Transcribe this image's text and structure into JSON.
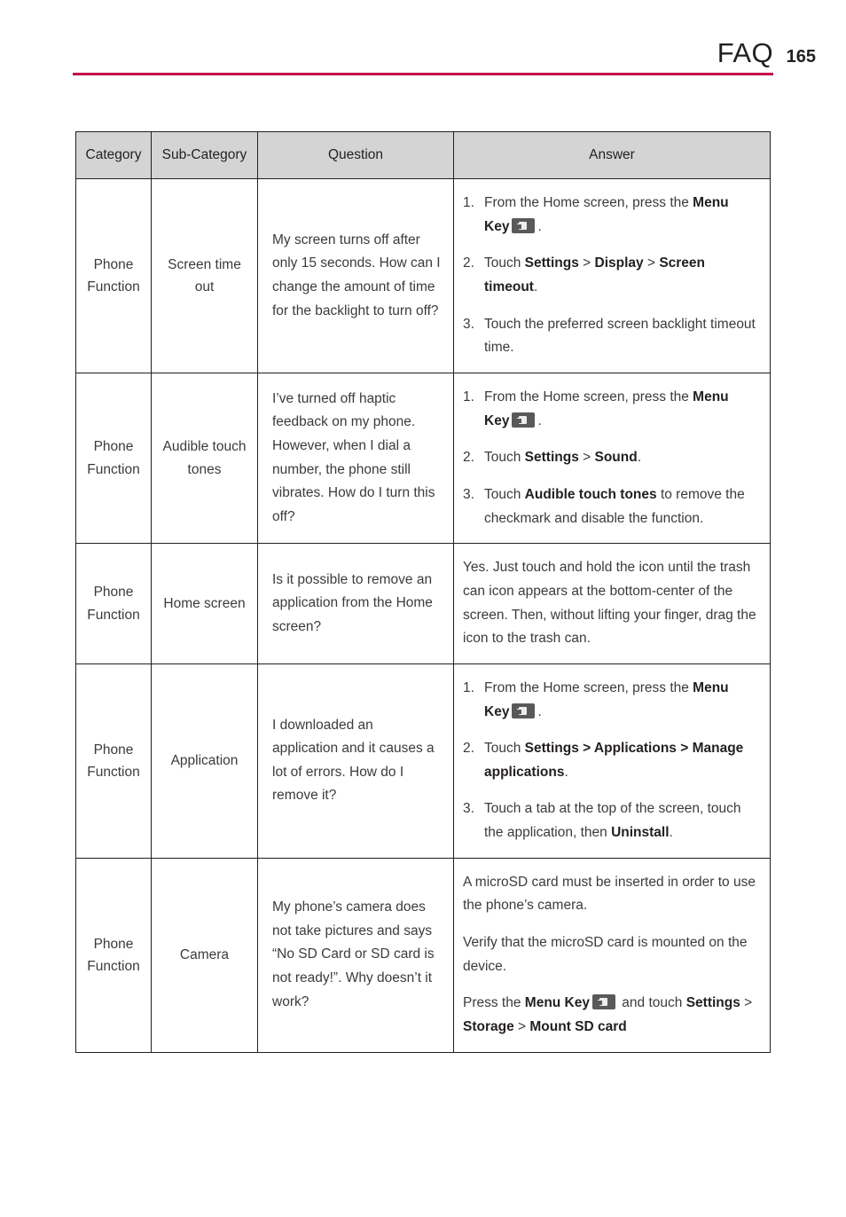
{
  "header": {
    "title": "FAQ",
    "page_number": "165",
    "rule_color": "#c4004d"
  },
  "table": {
    "header_bg": "#d4d4d4",
    "columns": [
      "Category",
      "Sub-Category",
      "Question",
      "Answer"
    ],
    "rows": [
      {
        "category": "Phone Function",
        "subcategory": "Screen time out",
        "question": "My screen turns off after only 15 seconds. How can I change the amount of time for the backlight to turn off?",
        "answer_steps": [
          {
            "num": "1.",
            "segments": [
              {
                "text": "From the Home screen, press the ",
                "bold": false
              },
              {
                "text": "Menu Key",
                "bold": true
              },
              {
                "icon": "menu-key-icon"
              },
              {
                "text": ".",
                "bold": false
              }
            ]
          },
          {
            "num": "2.",
            "segments": [
              {
                "text": "Touch ",
                "bold": false
              },
              {
                "text": "Settings",
                "bold": true
              },
              {
                "text": " > ",
                "bold": false
              },
              {
                "text": "Display",
                "bold": true
              },
              {
                "text": " > ",
                "bold": false
              },
              {
                "text": "Screen timeout",
                "bold": true
              },
              {
                "text": ".",
                "bold": false
              }
            ]
          },
          {
            "num": "3.",
            "segments": [
              {
                "text": "Touch the preferred screen backlight timeout time.",
                "bold": false
              }
            ]
          }
        ]
      },
      {
        "category": "Phone Function",
        "subcategory": "Audible touch tones",
        "question": "I’ve turned off haptic feedback on my phone. However, when I dial a number, the phone still vibrates. How do I turn this off?",
        "answer_steps": [
          {
            "num": "1.",
            "segments": [
              {
                "text": "From the Home screen, press the ",
                "bold": false
              },
              {
                "text": "Menu Key",
                "bold": true
              },
              {
                "icon": "menu-key-icon"
              },
              {
                "text": ".",
                "bold": false
              }
            ]
          },
          {
            "num": "2.",
            "segments": [
              {
                "text": "Touch ",
                "bold": false
              },
              {
                "text": "Settings",
                "bold": true
              },
              {
                "text": " > ",
                "bold": false
              },
              {
                "text": "Sound",
                "bold": true
              },
              {
                "text": ".",
                "bold": false
              }
            ]
          },
          {
            "num": "3.",
            "segments": [
              {
                "text": "Touch ",
                "bold": false
              },
              {
                "text": "Audible touch tones",
                "bold": true
              },
              {
                "text": " to remove the checkmark and disable the function.",
                "bold": false
              }
            ]
          }
        ]
      },
      {
        "category": "Phone Function",
        "subcategory": "Home screen",
        "question": "Is it possible to remove an application from the Home screen?",
        "answer_paragraphs": [
          {
            "segments": [
              {
                "text": "Yes. Just touch and hold the icon until the trash can icon appears at the bottom-center of the screen. Then, without lifting your finger, drag the icon to the trash can.",
                "bold": false
              }
            ]
          }
        ]
      },
      {
        "category": "Phone Function",
        "subcategory": "Application",
        "question": "I downloaded an application and it causes a lot of errors. How do I remove it?",
        "answer_steps": [
          {
            "num": "1.",
            "segments": [
              {
                "text": "From the Home screen, press the ",
                "bold": false
              },
              {
                "text": "Menu Key",
                "bold": true
              },
              {
                "icon": "menu-key-icon"
              },
              {
                "text": ".",
                "bold": false
              }
            ]
          },
          {
            "num": "2.",
            "segments": [
              {
                "text": "Touch ",
                "bold": false
              },
              {
                "text": "Settings > Applications > Manage applications",
                "bold": true
              },
              {
                "text": ".",
                "bold": false
              }
            ]
          },
          {
            "num": "3.",
            "segments": [
              {
                "text": "Touch a tab at the top of the screen, touch the application, then ",
                "bold": false
              },
              {
                "text": "Uninstall",
                "bold": true
              },
              {
                "text": ".",
                "bold": false
              }
            ]
          }
        ]
      },
      {
        "category": "Phone Function",
        "subcategory": "Camera",
        "question": "My phone’s camera does not take pictures and says “No SD Card or SD card is not ready!”. Why doesn’t it work?",
        "answer_paragraphs": [
          {
            "segments": [
              {
                "text": "A microSD card must be inserted in order to use the phone’s camera.",
                "bold": false
              }
            ]
          },
          {
            "segments": [
              {
                "text": "Verify that the microSD card is mounted on the device.",
                "bold": false
              }
            ]
          },
          {
            "segments": [
              {
                "text": "Press the ",
                "bold": false
              },
              {
                "text": "Menu Key",
                "bold": true
              },
              {
                "icon": "menu-key-icon"
              },
              {
                "text": " and touch ",
                "bold": false
              },
              {
                "text": "Settings",
                "bold": true
              },
              {
                "text": " > ",
                "bold": false
              },
              {
                "text": "Storage",
                "bold": true
              },
              {
                "text": " > ",
                "bold": false
              },
              {
                "text": "Mount SD card",
                "bold": true
              }
            ]
          }
        ]
      }
    ]
  }
}
